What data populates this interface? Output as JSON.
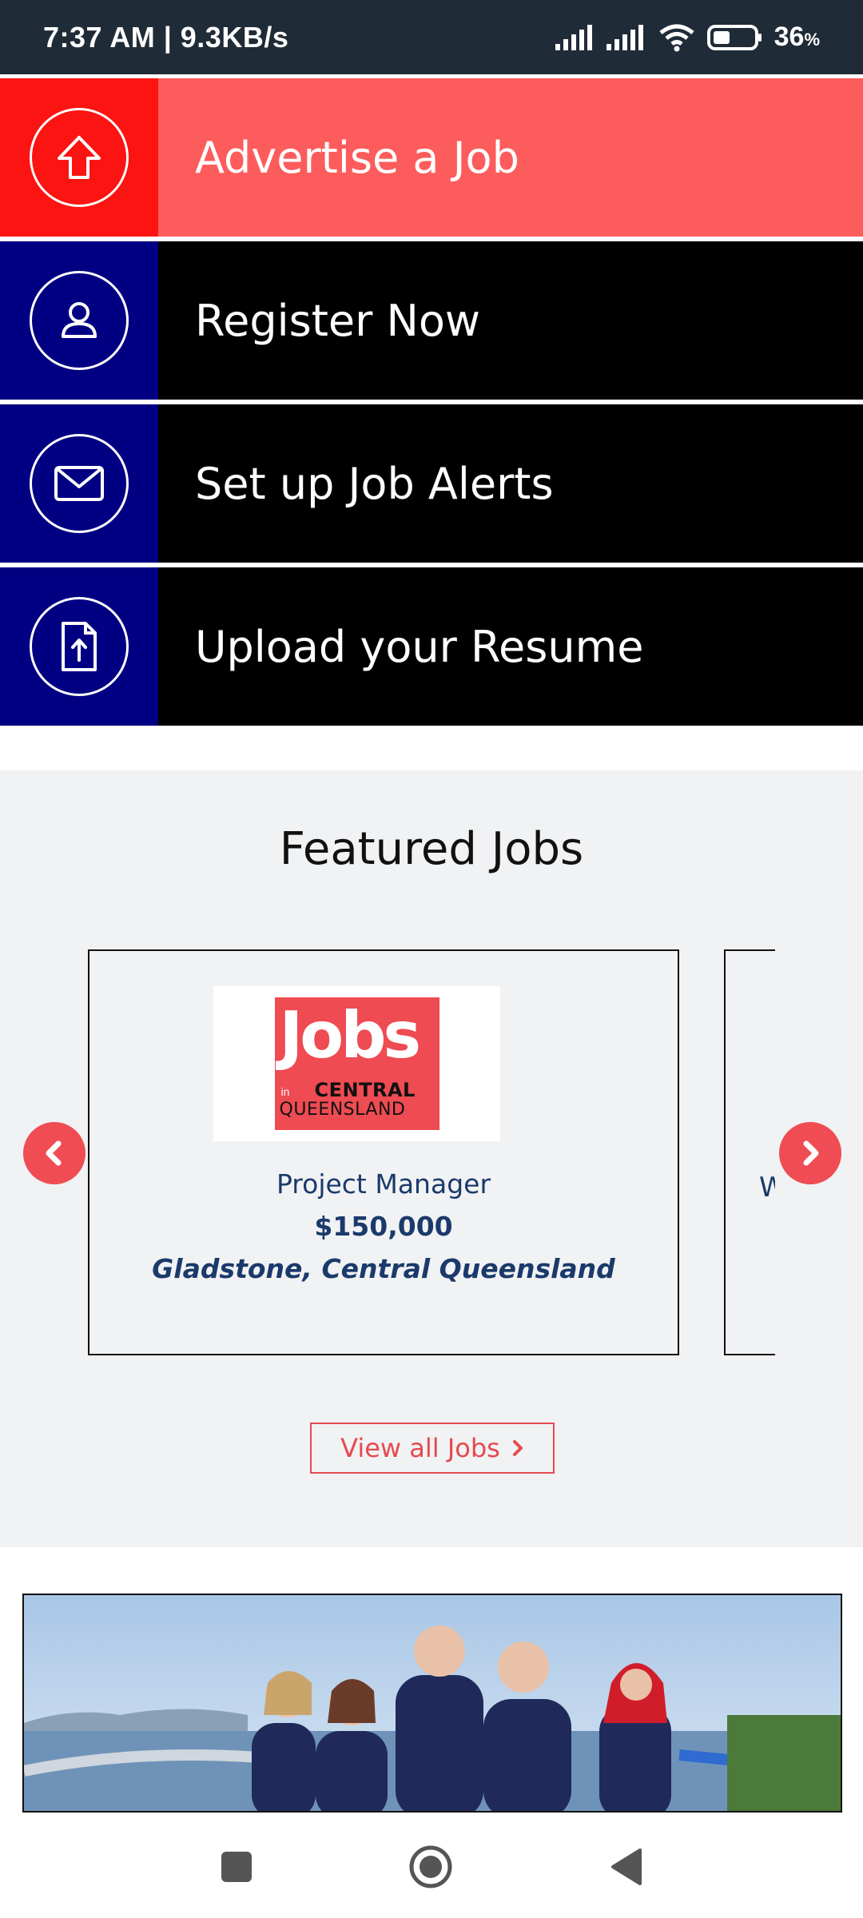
{
  "status_bar": {
    "time_speed": "7:37 AM | 9.3KB/s",
    "battery_percent": "36",
    "battery_unit": "%"
  },
  "actions": [
    {
      "label": "Advertise a Job",
      "icon": "upload-arrow-icon"
    },
    {
      "label": "Register Now",
      "icon": "user-icon"
    },
    {
      "label": "Set up Job Alerts",
      "icon": "envelope-icon"
    },
    {
      "label": "Upload your Resume",
      "icon": "file-upload-icon"
    }
  ],
  "featured": {
    "title": "Featured Jobs",
    "job": {
      "logo_main": "Jobs",
      "logo_in": "in",
      "logo_line1": "CENTRAL",
      "logo_line2": "QUEENSLAND",
      "title": "Project Manager",
      "salary": "$150,000",
      "location": "Gladstone, Central Queensland"
    },
    "next_card_peek": "W",
    "view_all_label": "View all Jobs"
  },
  "colors": {
    "status_bar_bg": "#1f2b37",
    "advertise_icon_bg": "#fb1411",
    "advertise_label_bg": "#fd5c5c",
    "navy": "#020082",
    "black": "#000000",
    "accent_red": "#ef4d53",
    "text_navy": "#1b3a6b",
    "section_bg": "#f1f2f4"
  }
}
